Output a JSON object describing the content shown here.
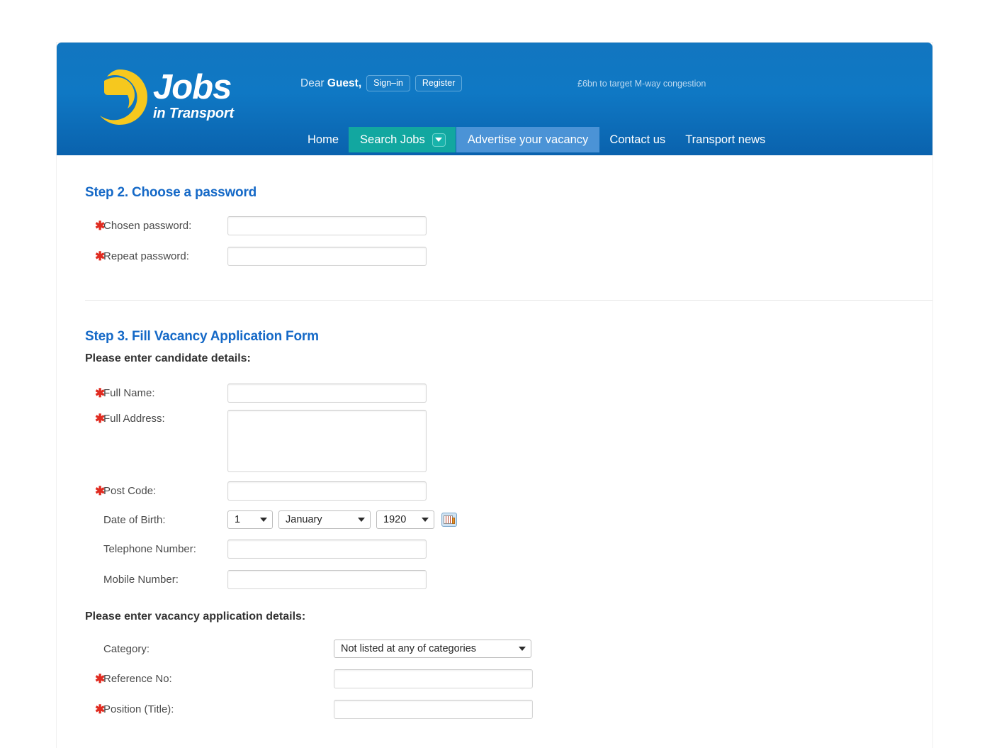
{
  "header": {
    "logo": {
      "main": "Jobs",
      "sub": "in Transport",
      "mark": "crescent-swoosh-logo"
    },
    "greeting_prefix": "Dear ",
    "greeting_name": "Guest,",
    "signin_label": "Sign–in",
    "register_label": "Register",
    "ticker_text": "£6bn to target M-way congestion",
    "nav": [
      {
        "label": "Home",
        "style": "plain"
      },
      {
        "label": "Search Jobs",
        "style": "teal",
        "caret": true
      },
      {
        "label": "Advertise your vacancy",
        "style": "lightblue"
      },
      {
        "label": "Contact us",
        "style": "plain"
      },
      {
        "label": "Transport news",
        "style": "plain"
      }
    ],
    "colors": {
      "header_top": "#1276c0",
      "header_bottom": "#0a62ad",
      "teal": "#12a7a0",
      "light_blue": "#4b93d6",
      "logo_yellow": "#f6c81e"
    }
  },
  "step2": {
    "heading": "Step 2. Choose a password",
    "fields": [
      {
        "label": "Chosen password:",
        "required": true,
        "value": "",
        "placeholder": ""
      },
      {
        "label": "Repeat password:",
        "required": true,
        "value": "",
        "placeholder": ""
      }
    ]
  },
  "step3": {
    "heading": "Step 3. Fill Vacancy Application Form",
    "candidate_subheading": "Please enter candidate details:",
    "vacancy_subheading": "Please enter vacancy application details:",
    "candidate_fields": {
      "full_name": {
        "label": "Full Name:",
        "required": true,
        "value": ""
      },
      "full_address": {
        "label": "Full Address:",
        "required": true,
        "value": ""
      },
      "post_code": {
        "label": "Post Code:",
        "required": true,
        "value": ""
      },
      "date_of_birth": {
        "label": "Date of Birth:",
        "required": false,
        "day": "1",
        "month": "January",
        "year": "1920",
        "calendar_icon": "calendar-icon"
      },
      "telephone": {
        "label": "Telephone Number:",
        "required": false,
        "value": ""
      },
      "mobile": {
        "label": "Mobile Number:",
        "required": false,
        "value": ""
      }
    },
    "vacancy_fields": {
      "category": {
        "label": "Category:",
        "required": false,
        "selected": "Not listed at any of categories"
      },
      "reference_no": {
        "label": "Reference No:",
        "required": true,
        "value": ""
      },
      "position_title": {
        "label": "Position (Title):",
        "required": true,
        "value": ""
      }
    }
  },
  "required_marker": "✱"
}
